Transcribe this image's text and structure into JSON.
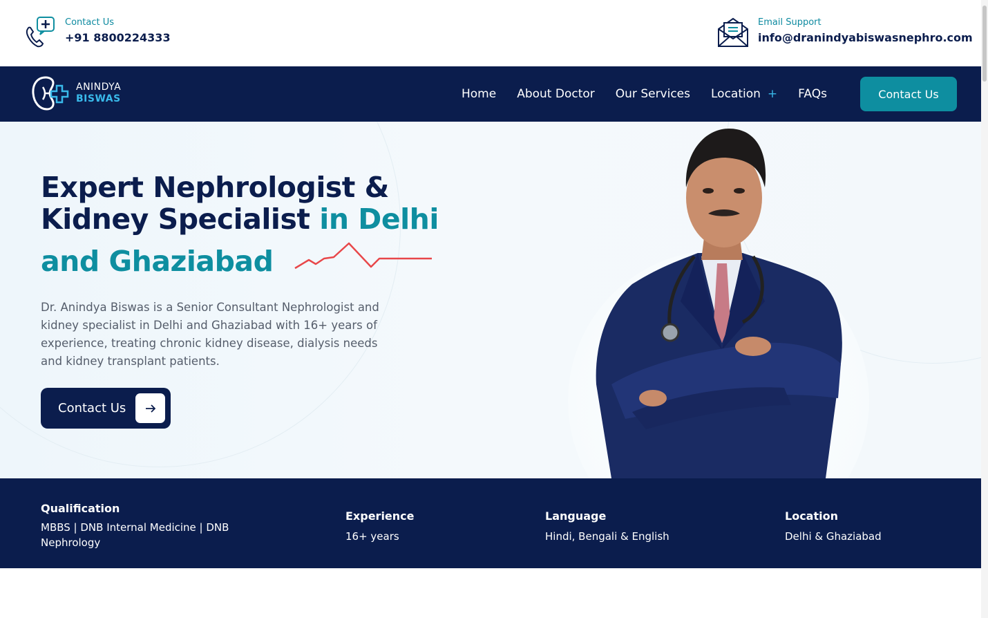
{
  "topbar": {
    "phone_label": "Contact Us",
    "phone_value": "+91 8800224333",
    "email_label": "Email Support",
    "email_value": "info@dranindyabiswasnephro.com"
  },
  "logo": {
    "line1": "ANINDYA",
    "line2": "BISWAS"
  },
  "nav": {
    "items": [
      {
        "label": "Home"
      },
      {
        "label": "About Doctor"
      },
      {
        "label": "Our Services"
      },
      {
        "label": "Location",
        "has_submenu": true
      },
      {
        "label": "FAQs"
      }
    ],
    "cta": "Contact Us"
  },
  "hero": {
    "title_line1": "Expert Nephrologist &",
    "title_line2_a": "Kidney Specialist",
    "title_line2_b": " in Delhi",
    "title_line3": "and Ghaziabad",
    "description": "Dr. Anindya Biswas is a Senior Consultant Nephrologist and kidney specialist in Delhi and Ghaziabad with 16+ years of experience, treating chronic kidney disease, dialysis needs and kidney transplant patients.",
    "cta": "Contact Us"
  },
  "stats": [
    {
      "title": "Qualification",
      "value": "MBBS | DNB Internal Medicine | DNB Nephrology"
    },
    {
      "title": "Experience",
      "value": "16+ years"
    },
    {
      "title": "Language",
      "value": "Hindi, Bengali & English"
    },
    {
      "title": "Location",
      "value": "Delhi & Ghaziabad"
    }
  ],
  "colors": {
    "navy": "#0b1d4d",
    "teal": "#0e8ea0",
    "accent_blue": "#39b9ea",
    "pulse_red": "#e8474a"
  },
  "icons": [
    "phone-icon",
    "mail-icon",
    "arrow-right-icon",
    "plus-icon",
    "kidney-logo-icon"
  ]
}
